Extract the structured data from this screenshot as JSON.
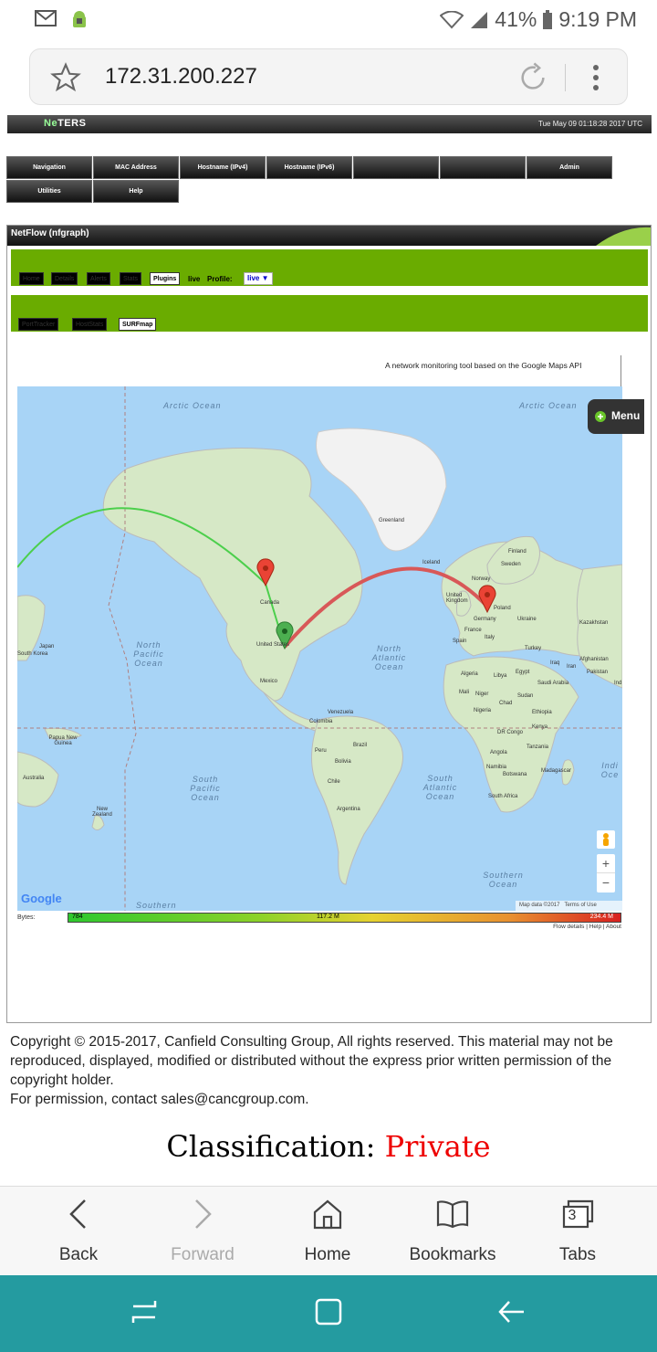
{
  "status": {
    "battery": "41%",
    "time": "9:19 PM"
  },
  "browser": {
    "url": "172.31.200.227"
  },
  "brand": {
    "name_prefix": "Ne",
    "name_suffix": "TERS",
    "datetime": "Tue May 09 01:18:28 2017 UTC"
  },
  "nav": {
    "row1": [
      "Navigation",
      "MAC Address",
      "Hostname (IPv4)",
      "Hostname (IPv6)",
      "",
      "",
      "Admin"
    ],
    "row2": [
      "Utilities",
      "Help"
    ]
  },
  "panel": {
    "title": "NetFlow (nfgraph)",
    "tabs1": [
      "Home",
      "Details",
      "Alerts",
      "Stats",
      "Plugins"
    ],
    "live_label": "live",
    "profile_label": "Profile:",
    "profile_value": "live ▼",
    "tabs2": [
      "PortTracker",
      "HostStats",
      "SURFmap"
    ],
    "tagline": "A network monitoring tool based on the Google Maps API"
  },
  "map": {
    "menu_label": "Menu",
    "oceans": [
      "Arctic Ocean",
      "Arctic Ocean",
      "North Pacific Ocean",
      "North Atlantic Ocean",
      "South Pacific Ocean",
      "South Atlantic Ocean",
      "Southern Ocean",
      "Southern",
      "Indi Oce"
    ],
    "countries": [
      "Greenland",
      "Iceland",
      "Finland",
      "Sweden",
      "Norway",
      "United Kingdom",
      "Poland",
      "Germany",
      "Ukraine",
      "Kazakhstan",
      "France",
      "Italy",
      "Spain",
      "Turkey",
      "Iraq",
      "Afghanistan",
      "Iran",
      "Pakistan",
      "Ind",
      "Algeria",
      "Libya",
      "Egypt",
      "Saudi Arabia",
      "Mali",
      "Niger",
      "Chad",
      "Sudan",
      "Nigeria",
      "Ethiopia",
      "DR Congo",
      "Kenya",
      "Tanzania",
      "Angola",
      "Namibia",
      "Botswana",
      "Madagascar",
      "South Africa",
      "Canada",
      "United States",
      "Mexico",
      "Venezuela",
      "Colombia",
      "Peru",
      "Brazil",
      "Bolivia",
      "Chile",
      "Argentina",
      "Japan",
      "South Korea",
      "Papua New Guinea",
      "Australia",
      "New Zealand"
    ],
    "attribution": "Map data ©2017",
    "terms": "Terms of Use",
    "google_logo": "Google"
  },
  "legend": {
    "label": "Bytes:",
    "min": "784",
    "mid": "117.2 M",
    "max": "234.4 M",
    "links": "Flow details | Help | About"
  },
  "footer": {
    "copyright": "Copyright © 2015-2017, Canfield Consulting Group, All rights reserved. This material may not be reproduced, displayed, modified or distributed without the express prior written permission of the copyright holder.",
    "permission": "For permission, contact sales@cancgroup.com.",
    "classification_label": "Classification:",
    "classification_value": "Private"
  },
  "bottom_bar": {
    "back": "Back",
    "forward": "Forward",
    "home": "Home",
    "bookmarks": "Bookmarks",
    "tabs": "Tabs",
    "tab_count": "3"
  },
  "colors": {
    "green_bar": "#6aac00",
    "nav_teal": "#249ba0",
    "private_red": "#ee0000"
  }
}
